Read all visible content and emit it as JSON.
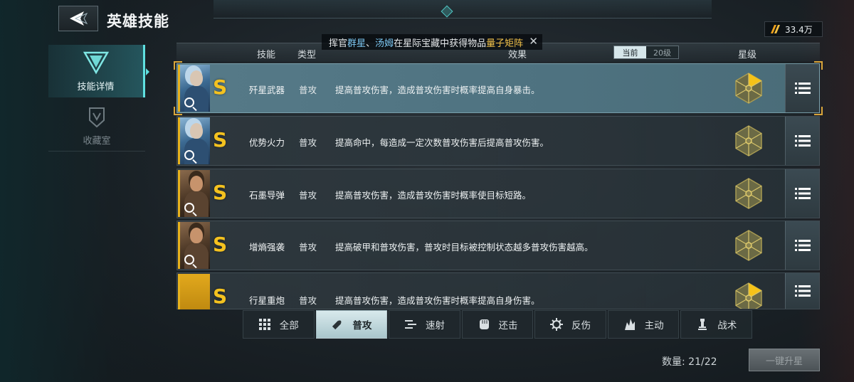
{
  "header": {
    "title": "英雄技能"
  },
  "currency": {
    "amount": "33.4万"
  },
  "sidebar": {
    "items": [
      {
        "label": "技能详情",
        "active": true
      },
      {
        "label": "收藏室",
        "active": false
      }
    ]
  },
  "notice": {
    "prefix": "挥官",
    "name1": "群星",
    "sep": "、",
    "name2": "汤姆",
    "middle": "在星际宝藏中获得物品",
    "item": "量子矩阵"
  },
  "table": {
    "headers": {
      "skill": "技能",
      "type": "类型",
      "effect": "效果",
      "star": "星级"
    },
    "level_toggle": {
      "current": "当前",
      "max": "20级"
    },
    "rows": [
      {
        "rank": "S",
        "name": "歼星武器",
        "type": "普攻",
        "effect": "提高普攻伤害，造成普攻伤害时概率提高自身暴击。",
        "portrait": "blue-haired-hero",
        "selected": true
      },
      {
        "rank": "S",
        "name": "优势火力",
        "type": "普攻",
        "effect": "提高命中，每造成一定次数普攻伤害后提高普攻伤害。",
        "portrait": "blue-haired-hero",
        "selected": false
      },
      {
        "rank": "S",
        "name": "石墨导弹",
        "type": "普攻",
        "effect": "提高普攻伤害，造成普攻伤害时概率使目标短路。",
        "portrait": "brown-haired-hero",
        "selected": false
      },
      {
        "rank": "S",
        "name": "增熵强袭",
        "type": "普攻",
        "effect": "提高破甲和普攻伤害，普攻时目标被控制状态越多普攻伤害越高。",
        "portrait": "brown-haired-hero",
        "selected": false
      },
      {
        "rank": "S",
        "name": "行星重炮",
        "type": "普攻",
        "effect": "提高普攻伤害，造成普攻伤害时概率提高自身伤害。",
        "portrait": "gold",
        "selected": false
      }
    ]
  },
  "filters": [
    {
      "label": "全部",
      "icon": "grid-icon"
    },
    {
      "label": "普攻",
      "icon": "bullet-icon",
      "active": true
    },
    {
      "label": "速射",
      "icon": "rapid-fire-icon"
    },
    {
      "label": "还击",
      "icon": "fist-icon"
    },
    {
      "label": "反伤",
      "icon": "gear-icon"
    },
    {
      "label": "主动",
      "icon": "flame-icon"
    },
    {
      "label": "战术",
      "icon": "chess-piece-icon"
    }
  ],
  "footer": {
    "count_label": "数量:",
    "count_value": "21/22",
    "upgrade_label": "一键升星"
  },
  "colors": {
    "accent": "#5fe0e0",
    "rank_gold": "#f4c21f",
    "highlight_blue": "#7cc7f2",
    "highlight_gold": "#f2c24a"
  }
}
